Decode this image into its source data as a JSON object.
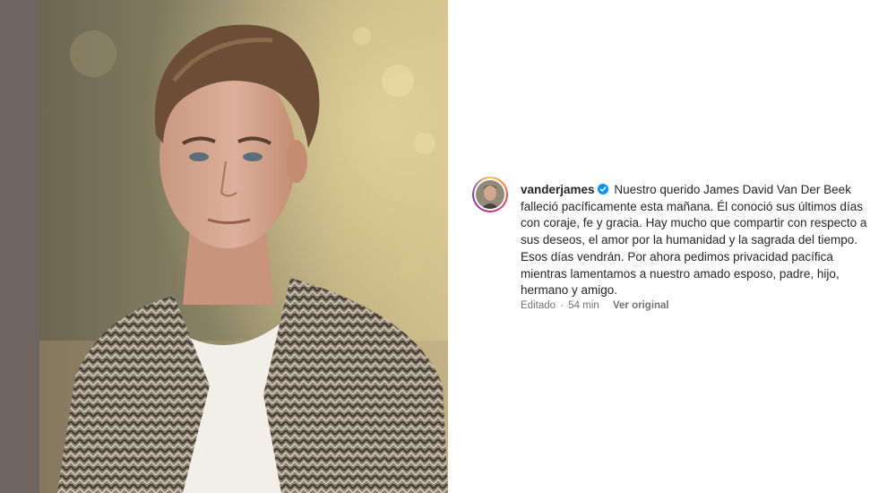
{
  "post": {
    "username": "vanderjames",
    "verified": true,
    "caption": "Nuestro querido James David Van Der Beek falleció pacíficamente esta mañana. Él conoció sus últimos días con coraje, fe y gracia. Hay mucho que compartir con respecto a sus deseos, el amor por la humanidad y la sagrada del tiempo. Esos días vendrán. Por ahora pedimos privacidad pacífica mientras lamentamos a nuestro amado esposo, padre, hijo, hermano y amigo.",
    "edited_label": "Editado",
    "separator": "·",
    "time_ago": "54 min",
    "see_original_label": "Ver original"
  },
  "icons": {
    "verified": "verified-badge-icon",
    "avatar": "profile-avatar"
  },
  "colors": {
    "verified_blue": "#0095f6",
    "text_primary": "#262626",
    "text_secondary": "#737373",
    "left_strip": "#6f6560"
  }
}
